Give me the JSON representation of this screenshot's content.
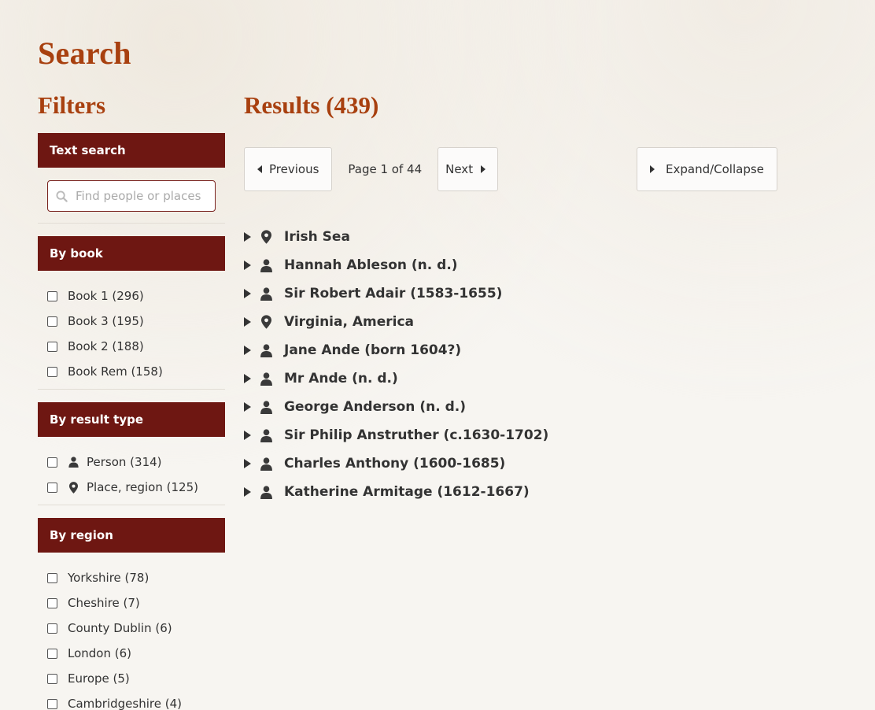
{
  "page": {
    "title": "Search"
  },
  "filters": {
    "title": "Filters",
    "text_search": {
      "heading": "Text search",
      "placeholder": "Find people or places"
    },
    "by_book": {
      "heading": "By book",
      "items": [
        "Book 1 (296)",
        "Book 3 (195)",
        "Book 2 (188)",
        "Book Rem (158)"
      ]
    },
    "by_result_type": {
      "heading": "By result type",
      "items": [
        {
          "icon": "person-icon",
          "label": "Person (314)"
        },
        {
          "icon": "map-pin-icon",
          "label": "Place, region (125)"
        }
      ]
    },
    "by_region": {
      "heading": "By region",
      "items": [
        "Yorkshire (78)",
        "Cheshire (7)",
        "County Dublin (6)",
        "London (6)",
        "Europe (5)",
        "Cambridgeshire (4)"
      ]
    }
  },
  "results": {
    "title": "Results (439)",
    "pager": {
      "previous": "Previous",
      "page_info": "Page 1 of 44",
      "next": "Next",
      "expand": "Expand/Collapse"
    },
    "items": [
      {
        "icon": "map-pin-icon",
        "label": "Irish Sea"
      },
      {
        "icon": "person-icon",
        "label": "Hannah Ableson (n. d.)"
      },
      {
        "icon": "person-icon",
        "label": "Sir Robert Adair (1583-1655)"
      },
      {
        "icon": "map-pin-icon",
        "label": "Virginia, America"
      },
      {
        "icon": "person-icon",
        "label": "Jane Ande (born 1604?)"
      },
      {
        "icon": "person-icon",
        "label": "Mr Ande (n. d.)"
      },
      {
        "icon": "person-icon",
        "label": "George Anderson (n. d.)"
      },
      {
        "icon": "person-icon",
        "label": "Sir Philip Anstruther (c.1630-1702)"
      },
      {
        "icon": "person-icon",
        "label": "Charles Anthony (1600-1685)"
      },
      {
        "icon": "person-icon",
        "label": "Katherine Armitage (1612-1667)"
      }
    ]
  },
  "colors": {
    "accent": "#a8400f",
    "filter_header": "#6e1712"
  }
}
